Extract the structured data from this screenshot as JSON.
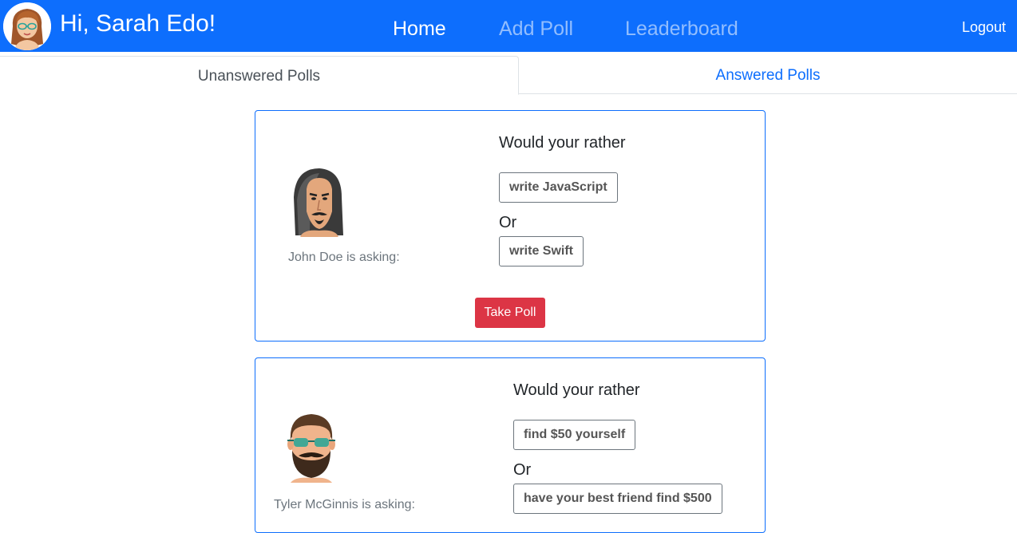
{
  "navbar": {
    "greeting": "Hi, Sarah Edo!",
    "links": {
      "home": "Home",
      "add_poll": "Add Poll",
      "leaderboard": "Leaderboard"
    },
    "active_link": "Home",
    "logout": "Logout",
    "avatar": "user-avatar-woman-glasses",
    "color": "#0d6efd"
  },
  "tabs": {
    "unanswered": "Unanswered Polls",
    "answered": "Answered Polls",
    "active": "Unanswered Polls"
  },
  "polls": [
    {
      "author_caption": "John Doe is asking:",
      "avatar": "avatar-long-hair-man",
      "question": "Would your rather",
      "option_one": "write JavaScript",
      "or_label": "Or",
      "option_two": "write Swift",
      "action": "Take Poll"
    },
    {
      "author_caption": "Tyler McGinnis is asking:",
      "avatar": "avatar-bearded-man-glasses",
      "question": "Would your rather",
      "option_one": "find $50 yourself",
      "or_label": "Or",
      "option_two": "have your best friend find $500"
    }
  ],
  "colors": {
    "primary": "#0d6efd",
    "danger": "#dc3545",
    "muted": "#6c757d"
  }
}
